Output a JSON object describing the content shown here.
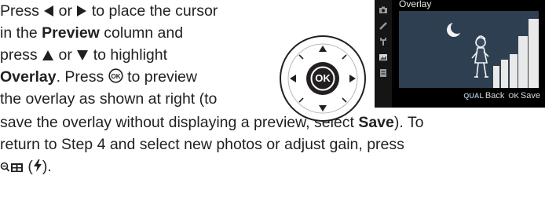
{
  "instructions": {
    "line1": {
      "a": "Press ",
      "b": " or ",
      "c": " to place the cursor"
    },
    "line2": {
      "a": "in the ",
      "b_bold": "Preview",
      "c": " column and"
    },
    "line3": {
      "a": "press ",
      "b": " or ",
      "c": " to highlight"
    },
    "line4": {
      "a_bold": "Overlay",
      "b": ". Press ",
      "c": " to preview"
    },
    "line5": {
      "a": "the overlay as shown at right (to"
    },
    "line6": {
      "a": "save the overlay without displaying a preview, select ",
      "b_bold": "Save",
      "c": ").  To"
    },
    "line7": {
      "a": "return to Step 4 and select new photos or adjust gain, press"
    },
    "line8": {
      "a": " (",
      "b": ")."
    }
  },
  "multi_selector": {
    "center_label": "OK"
  },
  "camera_screen": {
    "title": "Overlay",
    "back_chip": "QUAL",
    "back_label": "Back",
    "ok_chip": "OK",
    "save_label": "Save"
  },
  "colors": {
    "text": "#231f20",
    "screen_bg": "#000000",
    "preview_bg": "#2f3f52"
  }
}
